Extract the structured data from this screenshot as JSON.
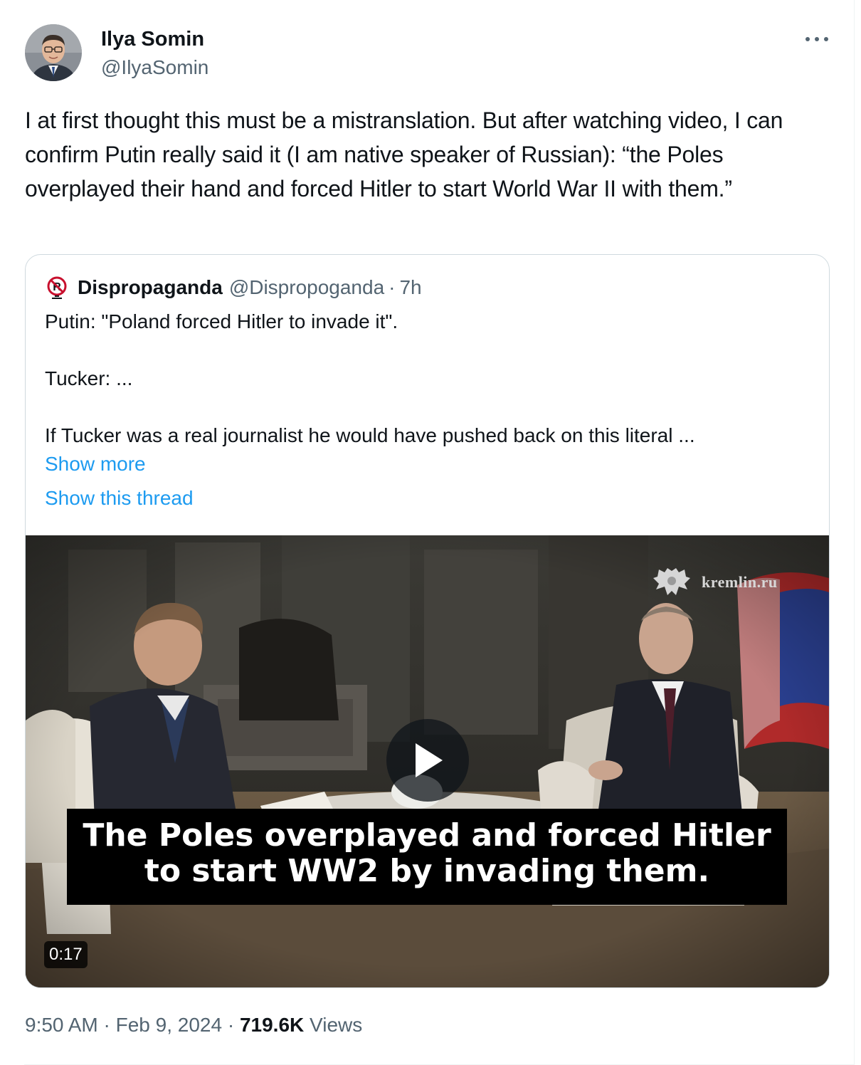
{
  "author": {
    "name": "Ilya Somin",
    "handle": "@IlyaSomin"
  },
  "tweet": {
    "text": "I at first thought this must be a mistranslation. But after watching video, I can confirm Putin really said it (I am native speaker of Russian): “the Poles overplayed their hand and forced Hitler to start World War II with them.”"
  },
  "quoted": {
    "name": "Dispropaganda",
    "handle": "@Dispropoganda",
    "separator": "·",
    "time": "7h",
    "lines": [
      "Putin: \"Poland forced Hitler to invade it\".",
      "Tucker: ...",
      "If Tucker was a real journalist he would have pushed back on this literal ..."
    ],
    "show_more": "Show more",
    "show_thread": "Show this thread",
    "video": {
      "watermark": "kremlin.ru",
      "subtitle_lines": [
        "The Poles overplayed and forced Hitler",
        "to start WW2 by invading them."
      ],
      "duration": "0:17"
    }
  },
  "footer": {
    "time": "9:50 AM",
    "sep1": "·",
    "date": "Feb 9, 2024",
    "sep2": "·",
    "views_count": "719.6K",
    "views_label": "Views"
  },
  "icons": {
    "more": "more-horizontal-icon",
    "play": "play-icon",
    "quoted_avatar": "no-propaganda-logo"
  },
  "colors": {
    "text": "#0f1419",
    "secondary": "#536471",
    "link": "#1d9bf0",
    "border": "#cfd9de"
  }
}
